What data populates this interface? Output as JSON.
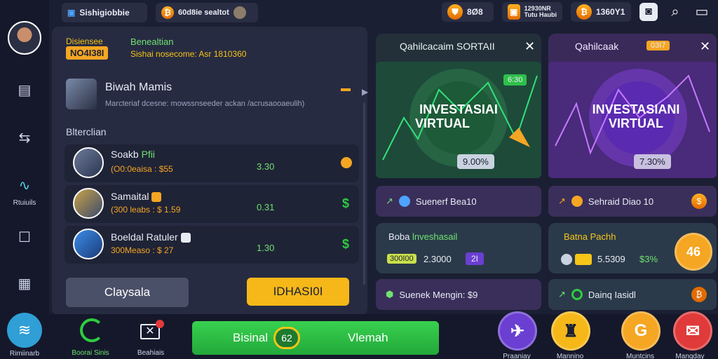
{
  "header": {
    "app_label": "Sishigiobbie",
    "tab_label": "60d8ie sealtot",
    "currency1": "8Ø8",
    "currency2": "12930NR\nTutu Haubi",
    "currency3": "1360Y1"
  },
  "rail": {
    "items": [
      {
        "label": "Rtuiuils"
      },
      {
        "label": "Rimiinarb"
      }
    ]
  },
  "balance": {
    "title": "Disiensee",
    "value": "NO4I38I",
    "sub_title": "Benealtian",
    "sub_text": "Sishai nosecome: Asr 1810360"
  },
  "profile": {
    "name": "Biwah Mamis",
    "desc": "Marcteriaf dcesne: mowssnseeder ackan /acrusaooaeulih)"
  },
  "list": {
    "heading": "Blterclian",
    "items": [
      {
        "name": "Soakb",
        "tag": "Pfii",
        "sub": "(O0:0eaisa : $55",
        "value": "3.30",
        "color": "#f5a623"
      },
      {
        "name": "Samaital",
        "tag": "",
        "sub": "(300 leabs : $ 1.59",
        "value": "0.31",
        "color": "#2ecc40"
      },
      {
        "name": "Boeldal Ratuler",
        "tag": "",
        "sub": "300Measo : $ 27",
        "value": "1.30",
        "color": "#2ecc40"
      }
    ],
    "btn_left": "Claysala",
    "btn_right": "IDHASI0I"
  },
  "card_green": {
    "title": "Qahilcacaim SORTAII",
    "big1": "INVESTASIAI",
    "big2": "VIRTUAL",
    "pct": "9.00%",
    "badge": "6:30"
  },
  "card_purple": {
    "title": "Qahilcaak",
    "tag": "03I7",
    "big1": "INVESTASIANI",
    "big2": "VIRTUAL",
    "pct": "7.30%"
  },
  "strips": {
    "g1": "Suenerf Bea10",
    "p1": "Sehraid Diao 10",
    "g2_title": "Boba",
    "g2_title2": "lnveshasail",
    "g2_badge": "300I00",
    "g2_value": "2.3000",
    "g2_num": "2I",
    "p2_title": "Batna",
    "p2_title2": "Pachh",
    "p2_value": "5.5309",
    "p2_pct": "$3%",
    "p2_bubble": "46",
    "g3": "Suenek Mengin: $9",
    "p3": "Dainq Iasidl"
  },
  "bottom": {
    "nav1": "Boorai Sinis",
    "nav2": "Beahiais",
    "main_left": "Bisinal",
    "main_num": "62",
    "main_right": "Vlemah",
    "c1": "Praaniay",
    "c2": "Mannino",
    "c3": "Muntcins",
    "c4": "Manqday"
  },
  "colors": {
    "green": "#2fbf4a",
    "purple": "#6a3fd1",
    "gold": "#f5c518"
  }
}
